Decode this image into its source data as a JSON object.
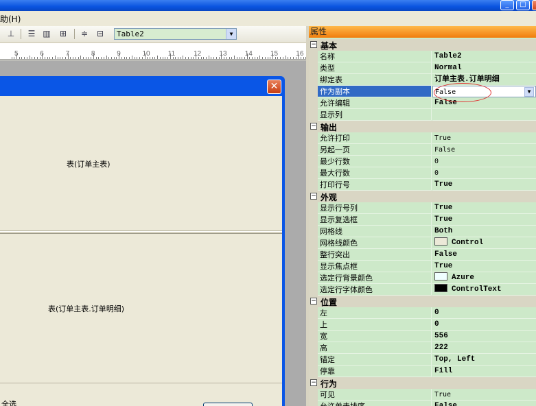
{
  "menu": {
    "help": "助(H)"
  },
  "toolbar": {
    "table_select_value": "Table2",
    "table_select_arrow": "▼"
  },
  "ruler": {
    "numbers": [
      "5",
      "6",
      "7",
      "8",
      "9",
      "10",
      "11",
      "12",
      "13",
      "14",
      "15",
      "16"
    ]
  },
  "form": {
    "master_label": "表(订单主表)",
    "detail_label": "表(订单主表.订单明细)",
    "select_all": "全选"
  },
  "property_grid": {
    "title": "属性",
    "categories": [
      {
        "name": "基本",
        "rows": [
          {
            "name": "名称",
            "value": "Table2",
            "style": "bold"
          },
          {
            "name": "类型",
            "value": "Normal",
            "style": "bold"
          },
          {
            "name": "绑定表",
            "value": "订单主表.订单明细",
            "style": "bold"
          },
          {
            "name": "作为副本",
            "value": "False",
            "style": "edit"
          },
          {
            "name": "允许编辑",
            "value": "False",
            "style": "bold"
          },
          {
            "name": "显示列",
            "value": "",
            "style": ""
          }
        ]
      },
      {
        "name": "输出",
        "rows": [
          {
            "name": "允许打印",
            "value": "True",
            "style": ""
          },
          {
            "name": "另起一页",
            "value": "False",
            "style": ""
          },
          {
            "name": "最少行数",
            "value": "0",
            "style": ""
          },
          {
            "name": "最大行数",
            "value": "0",
            "style": ""
          },
          {
            "name": "打印行号",
            "value": "True",
            "style": "bold"
          }
        ]
      },
      {
        "name": "外观",
        "rows": [
          {
            "name": "显示行号列",
            "value": "True",
            "style": "bold"
          },
          {
            "name": "显示复选框",
            "value": "True",
            "style": "bold"
          },
          {
            "name": "网格线",
            "value": "Both",
            "style": "bold"
          },
          {
            "name": "网格线颜色",
            "value": "Control",
            "style": "bold",
            "swatch": "#ece9d8"
          },
          {
            "name": "整行突出",
            "value": "False",
            "style": "bold"
          },
          {
            "name": "显示焦点框",
            "value": "True",
            "style": "bold"
          },
          {
            "name": "选定行背景颜色",
            "value": "Azure",
            "style": "bold",
            "swatch": "#f0ffff"
          },
          {
            "name": "选定行字体颜色",
            "value": "ControlText",
            "style": "bold",
            "swatch": "#000000"
          }
        ]
      },
      {
        "name": "位置",
        "rows": [
          {
            "name": "左",
            "value": "0",
            "style": "bold"
          },
          {
            "name": "上",
            "value": "0",
            "style": "bold"
          },
          {
            "name": "宽",
            "value": "556",
            "style": "bold"
          },
          {
            "name": "高",
            "value": "222",
            "style": "bold"
          },
          {
            "name": "锚定",
            "value": "Top, Left",
            "style": "bold"
          },
          {
            "name": "停靠",
            "value": "Fill",
            "style": "bold"
          }
        ]
      },
      {
        "name": "行为",
        "rows": [
          {
            "name": "可见",
            "value": "True",
            "style": ""
          },
          {
            "name": "允许单击排序",
            "value": "False",
            "style": "bold"
          }
        ]
      }
    ],
    "collapse_glyph": "−",
    "dropdown_arrow": "▼"
  },
  "colors": {
    "titlebar": "#0a54e0",
    "selection": "#316ac5",
    "grid_bg": "#cde9c9",
    "header_orange": "#f07d0c"
  }
}
